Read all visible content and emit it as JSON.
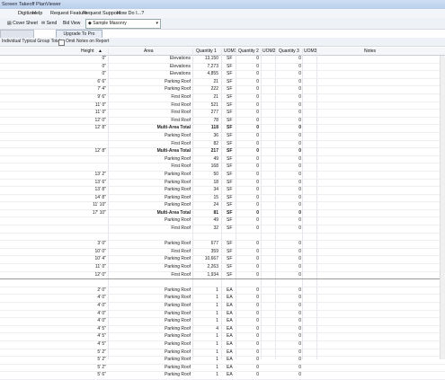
{
  "window": {
    "title": "Screen Takeoff PlanViewer"
  },
  "menu": [
    "Digitizer",
    "Help",
    "Request Feature",
    "Request Support",
    "How Do I...?"
  ],
  "toolbar": {
    "cover_sheet": "Cover Sheet",
    "send": "Send",
    "bid_view": "Bid View",
    "view_select": "Sample Masonry"
  },
  "tabs": {
    "upgrade": "Upgrade To Pro"
  },
  "options": {
    "group_totals": "Individual Typical Group Totals",
    "omit_notes": "Omit Notes on Report"
  },
  "columns": {
    "height": "Height",
    "area": "Area",
    "q1": "Quantity 1",
    "u1": "UOM1",
    "q2": "Quantity 2",
    "u2": "UOM2",
    "q3": "Quantity 3",
    "u3": "UOM3",
    "notes": "Notes"
  },
  "rows": [
    {
      "h": "0\"",
      "a": "Elevations",
      "q1": "13,150",
      "u1": "SF",
      "q2": "0",
      "q3": "0"
    },
    {
      "h": "0\"",
      "a": "Elevations",
      "q1": "7,273",
      "u1": "SF",
      "q2": "0",
      "q3": "0"
    },
    {
      "h": "0\"",
      "a": "Elevations",
      "q1": "4,855",
      "u1": "SF",
      "q2": "0",
      "q3": "0"
    },
    {
      "h": "6' 6\"",
      "a": "Parking Roof",
      "q1": "21",
      "u1": "SF",
      "q2": "0",
      "q3": "0"
    },
    {
      "h": "7' 4\"",
      "a": "Parking Roof",
      "q1": "222",
      "u1": "SF",
      "q2": "0",
      "q3": "0"
    },
    {
      "h": "9' 6\"",
      "a": "First Roof",
      "q1": "21",
      "u1": "SF",
      "q2": "0",
      "q3": "0"
    },
    {
      "h": "11' 0\"",
      "a": "First Roof",
      "q1": "521",
      "u1": "SF",
      "q2": "0",
      "q3": "0"
    },
    {
      "h": "11' 0\"",
      "a": "First Roof",
      "q1": "277",
      "u1": "SF",
      "q2": "0",
      "q3": "0"
    },
    {
      "h": "12' 0\"",
      "a": "First Roof",
      "q1": "78",
      "u1": "SF",
      "q2": "0",
      "q3": "0"
    },
    {
      "h": "12' 8\"",
      "a": "Multi-Area Total",
      "q1": "118",
      "u1": "SF",
      "q2": "0",
      "q3": "0",
      "b": true
    },
    {
      "h": "",
      "a": "Parking Roof",
      "q1": "36",
      "u1": "SF",
      "q2": "0",
      "q3": "0"
    },
    {
      "h": "",
      "a": "First Roof",
      "q1": "82",
      "u1": "SF",
      "q2": "0",
      "q3": "0"
    },
    {
      "h": "12' 8\"",
      "a": "Multi-Area Total",
      "q1": "217",
      "u1": "SF",
      "q2": "0",
      "q3": "0",
      "b": true
    },
    {
      "h": "",
      "a": "Parking Roof",
      "q1": "49",
      "u1": "SF",
      "q2": "0",
      "q3": "0"
    },
    {
      "h": "",
      "a": "First Roof",
      "q1": "168",
      "u1": "SF",
      "q2": "0",
      "q3": "0"
    },
    {
      "h": "13' 2\"",
      "a": "Parking Roof",
      "q1": "50",
      "u1": "SF",
      "q2": "0",
      "q3": "0"
    },
    {
      "h": "13' 6\"",
      "a": "Parking Roof",
      "q1": "18",
      "u1": "SF",
      "q2": "0",
      "q3": "0"
    },
    {
      "h": "13' 8\"",
      "a": "Parking Roof",
      "q1": "34",
      "u1": "SF",
      "q2": "0",
      "q3": "0"
    },
    {
      "h": "14' 8\"",
      "a": "Parking Roof",
      "q1": "15",
      "u1": "SF",
      "q2": "0",
      "q3": "0"
    },
    {
      "h": "11' 10\"",
      "a": "Parking Roof",
      "q1": "24",
      "u1": "SF",
      "q2": "0",
      "q3": "0"
    },
    {
      "h": "17' 10\"",
      "a": "Multi-Area Total",
      "q1": "81",
      "u1": "SF",
      "q2": "0",
      "q3": "0",
      "b": true
    },
    {
      "h": "",
      "a": "Parking Roof",
      "q1": "49",
      "u1": "SF",
      "q2": "0",
      "q3": "0"
    },
    {
      "h": "",
      "a": "First Roof",
      "q1": "32",
      "u1": "SF",
      "q2": "0",
      "q3": "0"
    },
    {
      "gap": true
    },
    {
      "h": "3' 0\"",
      "a": "Parking Roof",
      "q1": "677",
      "u1": "SF",
      "q2": "0",
      "q3": "0"
    },
    {
      "h": "10' 0\"",
      "a": "First Roof",
      "q1": "359",
      "u1": "SF",
      "q2": "0",
      "q3": "0"
    },
    {
      "h": "10' 4\"",
      "a": "Parking Roof",
      "q1": "10,667",
      "u1": "SF",
      "q2": "0",
      "q3": "0"
    },
    {
      "h": "11' 0\"",
      "a": "Parking Roof",
      "q1": "2,263",
      "u1": "SF",
      "q2": "0",
      "q3": "0"
    },
    {
      "h": "12' 0\"",
      "a": "First Roof",
      "q1": "1,934",
      "u1": "SF",
      "q2": "0",
      "q3": "0",
      "thick": true
    },
    {
      "gap": true
    },
    {
      "h": "2' 0\"",
      "a": "Parking Roof",
      "q1": "1",
      "u1": "EA",
      "q2": "0",
      "q3": "0"
    },
    {
      "h": "4' 0\"",
      "a": "Parking Roof",
      "q1": "1",
      "u1": "EA",
      "q2": "0",
      "q3": "0"
    },
    {
      "h": "4' 0\"",
      "a": "Parking Roof",
      "q1": "1",
      "u1": "EA",
      "q2": "0",
      "q3": "0"
    },
    {
      "h": "4' 0\"",
      "a": "Parking Roof",
      "q1": "1",
      "u1": "EA",
      "q2": "0",
      "q3": "0"
    },
    {
      "h": "4' 0\"",
      "a": "Parking Roof",
      "q1": "1",
      "u1": "EA",
      "q2": "0",
      "q3": "0"
    },
    {
      "h": "4' 5\"",
      "a": "Parking Roof",
      "q1": "4",
      "u1": "EA",
      "q2": "0",
      "q3": "0"
    },
    {
      "h": "4' 5\"",
      "a": "Parking Roof",
      "q1": "1",
      "u1": "EA",
      "q2": "0",
      "q3": "0"
    },
    {
      "h": "4' 5\"",
      "a": "Parking Roof",
      "q1": "1",
      "u1": "EA",
      "q2": "0",
      "q3": "0"
    },
    {
      "h": "5' 2\"",
      "a": "Parking Roof",
      "q1": "1",
      "u1": "EA",
      "q2": "0",
      "q3": "0"
    },
    {
      "h": "5' 2\"",
      "a": "Parking Roof",
      "q1": "1",
      "u1": "EA",
      "q2": "0",
      "q3": "0"
    },
    {
      "h": "5' 2\"",
      "a": "Parking Roof",
      "q1": "1",
      "u1": "EA",
      "q2": "0",
      "q3": "0"
    },
    {
      "h": "5' 6\"",
      "a": "Parking Roof",
      "q1": "1",
      "u1": "EA",
      "q2": "0",
      "q3": "0"
    }
  ]
}
